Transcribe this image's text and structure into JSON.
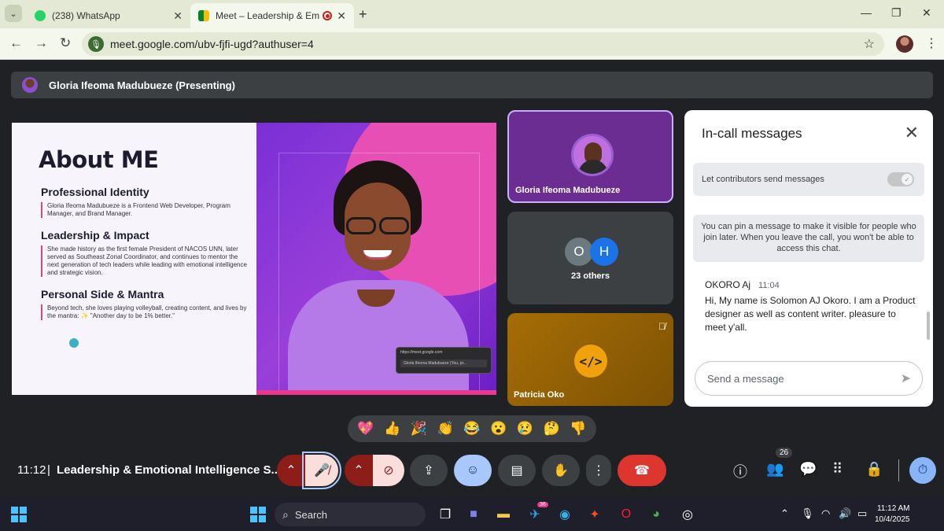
{
  "browser": {
    "tabs": [
      {
        "title": "(238) WhatsApp"
      },
      {
        "title": "Meet – Leadership & Emotio"
      }
    ],
    "url": "meet.google.com/ubv-fjfi-ugd?authuser=4"
  },
  "meet": {
    "presenter_label": "Gloria Ifeoma Madubueze (Presenting)",
    "slide": {
      "title": "About ME",
      "sections": [
        {
          "heading": "Professional Identity",
          "body": "Gloria Ifeoma Madubueze is a Frontend Web Developer, Program Manager, and Brand Manager."
        },
        {
          "heading": "Leadership & Impact",
          "body": "She made history as the first female President of NACOS UNN, later served as Southeast Zonal Coordinator, and continues to mentor the next generation of tech leaders while leading with emotional intelligence and strategic vision."
        },
        {
          "heading": "Personal Side & Mantra",
          "body": "Beyond tech, she loves playing volleyball, creating content, and lives by the mantra: ✨ \"Another day to be 1% better.\""
        }
      ],
      "mini_window_url": "https://meet.google.com",
      "mini_window_label": "Gloria Ifeoma Madubueze (You, pr..."
    },
    "tiles": {
      "gloria_name": "Gloria Ifeoma Madubueze",
      "others_initials": [
        "O",
        "H"
      ],
      "others_label": "23 others",
      "patricia_name": "Patricia Oko",
      "patricia_icon_text": "</>"
    },
    "chat": {
      "title": "In-call messages",
      "toggle_label": "Let contributors send messages",
      "toggle_on": true,
      "info_text": "You can pin a message to make it visible for people who join later. When you leave the call, you won't be able to access this chat.",
      "messages": [
        {
          "sender": "OKORO Aj",
          "time": "11:04",
          "text": "Hi, My name is Solomon AJ Okoro. I am a Product designer as well as content writer. pleasure to meet y'all."
        }
      ],
      "input_placeholder": "Send a message"
    },
    "reactions": [
      "💖",
      "👍",
      "🎉",
      "👏",
      "😂",
      "😮",
      "😢",
      "🤔",
      "👎"
    ],
    "bottom": {
      "time": "11:12",
      "separator": "|",
      "meeting_title": "Leadership & Emotional Intelligence S...",
      "people_count": "26"
    }
  },
  "taskbar": {
    "search_label": "Search",
    "time": "11:12 AM",
    "date": "10/4/2025",
    "telegram_badge": "36"
  },
  "colors": {
    "meet_bg": "#202124",
    "end_call": "#dc362e",
    "presenter_tile": "#6b2d91",
    "patricia_tile": "#a66d06",
    "chrome_bg": "#e3e9d4"
  }
}
